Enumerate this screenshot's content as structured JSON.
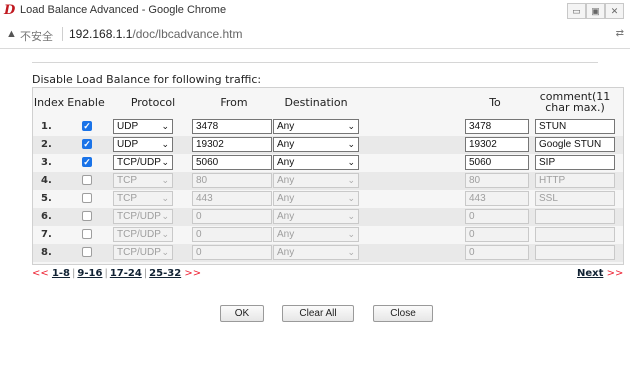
{
  "window": {
    "title": "Load Balance Advanced - Google Chrome",
    "min": "▭",
    "max": "▣",
    "close": "✕"
  },
  "address": {
    "insecure": "不安全",
    "host": "192.168.1.1",
    "path": "/doc/lbcadvance.htm"
  },
  "section_title": "Disable Load Balance for following traffic:",
  "headers": {
    "index": "Index",
    "enable": "Enable",
    "protocol": "Protocol",
    "from": "From",
    "destination": "Destination",
    "to": "To",
    "comment": "comment(11 char max.)"
  },
  "rows": [
    {
      "index": "1.",
      "enabled": true,
      "check": "✓",
      "protocol": "UDP",
      "from": "3478",
      "destination": "Any",
      "to": "3478",
      "comment": "STUN"
    },
    {
      "index": "2.",
      "enabled": true,
      "check": "✓",
      "protocol": "UDP",
      "from": "19302",
      "destination": "Any",
      "to": "19302",
      "comment": "Google STUN"
    },
    {
      "index": "3.",
      "enabled": true,
      "check": "✓",
      "protocol": "TCP/UDP",
      "from": "5060",
      "destination": "Any",
      "to": "5060",
      "comment": "SIP"
    },
    {
      "index": "4.",
      "enabled": false,
      "check": "",
      "protocol": "TCP",
      "from": "80",
      "destination": "Any",
      "to": "80",
      "comment": "HTTP"
    },
    {
      "index": "5.",
      "enabled": false,
      "check": "",
      "protocol": "TCP",
      "from": "443",
      "destination": "Any",
      "to": "443",
      "comment": "SSL"
    },
    {
      "index": "6.",
      "enabled": false,
      "check": "",
      "protocol": "TCP/UDP",
      "from": "0",
      "destination": "Any",
      "to": "0",
      "comment": ""
    },
    {
      "index": "7.",
      "enabled": false,
      "check": "",
      "protocol": "TCP/UDP",
      "from": "0",
      "destination": "Any",
      "to": "0",
      "comment": ""
    },
    {
      "index": "8.",
      "enabled": false,
      "check": "",
      "protocol": "TCP/UDP",
      "from": "0",
      "destination": "Any",
      "to": "0",
      "comment": ""
    }
  ],
  "pager": {
    "prev": "<<",
    "pages": [
      "1-8",
      "9-16",
      "17-24",
      "25-32"
    ],
    "sep": "|",
    "after": ">>",
    "next_label": "Next",
    "next_arrow": ">>"
  },
  "buttons": {
    "ok": "OK",
    "clear_all": "Clear All",
    "close": "Close"
  },
  "icons": {
    "warning": "▲",
    "dropdown": "⌄",
    "app": "D",
    "translate": "⇄"
  }
}
